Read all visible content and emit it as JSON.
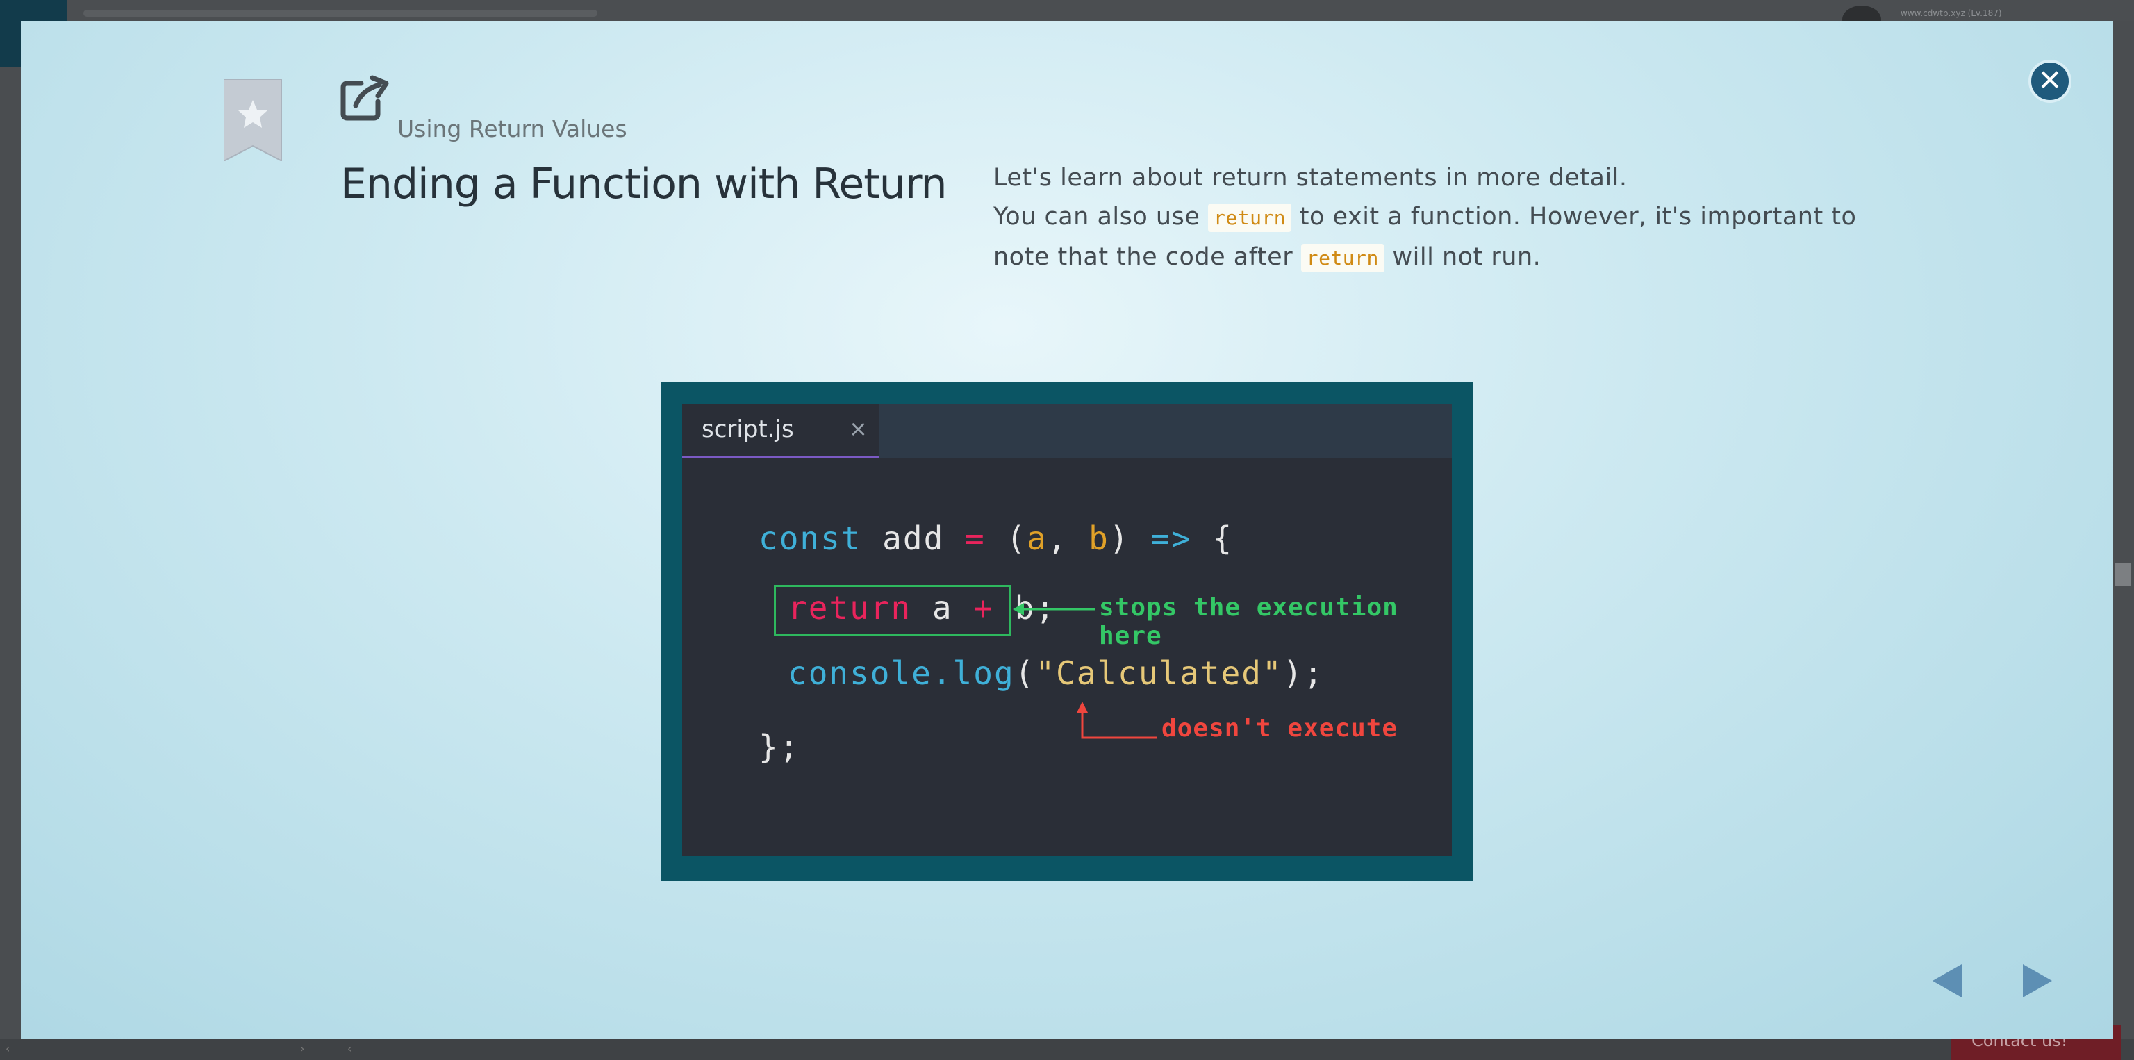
{
  "background": {
    "user_label": "www.cdwtp.xyz (Lv.187)",
    "contact_label": "Contact us!"
  },
  "lesson": {
    "subtitle": "Using Return Values",
    "title": "Ending a Function with Return",
    "desc_line1": "Let's learn about return statements in more detail.",
    "desc_line2_pre": "You can also use",
    "desc_line2_code": "return",
    "desc_line2_post": "to exit a function. However, it's important to",
    "desc_line3_pre": "note that the code after",
    "desc_line3_code": "return",
    "desc_line3_post": "will not run."
  },
  "illustration": {
    "tab_label": "script.js",
    "tab_close": "×",
    "line1": {
      "kw_const": "const",
      "name": " add ",
      "eq": "=",
      "open": " (",
      "a": "a",
      "comma": ", ",
      "b": "b",
      "close": ") ",
      "arrow": "=>",
      "brace": " {"
    },
    "line2": {
      "kw_return": "return",
      "expr_a": " a ",
      "plus": "+",
      "expr_b": " b;"
    },
    "line3": {
      "obj": "console.log",
      "paren_open": "(",
      "str": "\"Calculated\"",
      "paren_close": ");"
    },
    "line4": "};",
    "annotation_stop": "stops the execution here",
    "annotation_not": "doesn't execute"
  },
  "icons": {
    "bookmark": "star-bookmark-icon",
    "share": "external-link-icon",
    "close": "close-icon",
    "prev": "arrow-left-icon",
    "next": "arrow-right-icon"
  },
  "colors": {
    "close_button": "#1f5a7c",
    "nav_arrows": "#5d8fb4",
    "annotation_green": "#34c766",
    "annotation_red": "#f0463e"
  }
}
